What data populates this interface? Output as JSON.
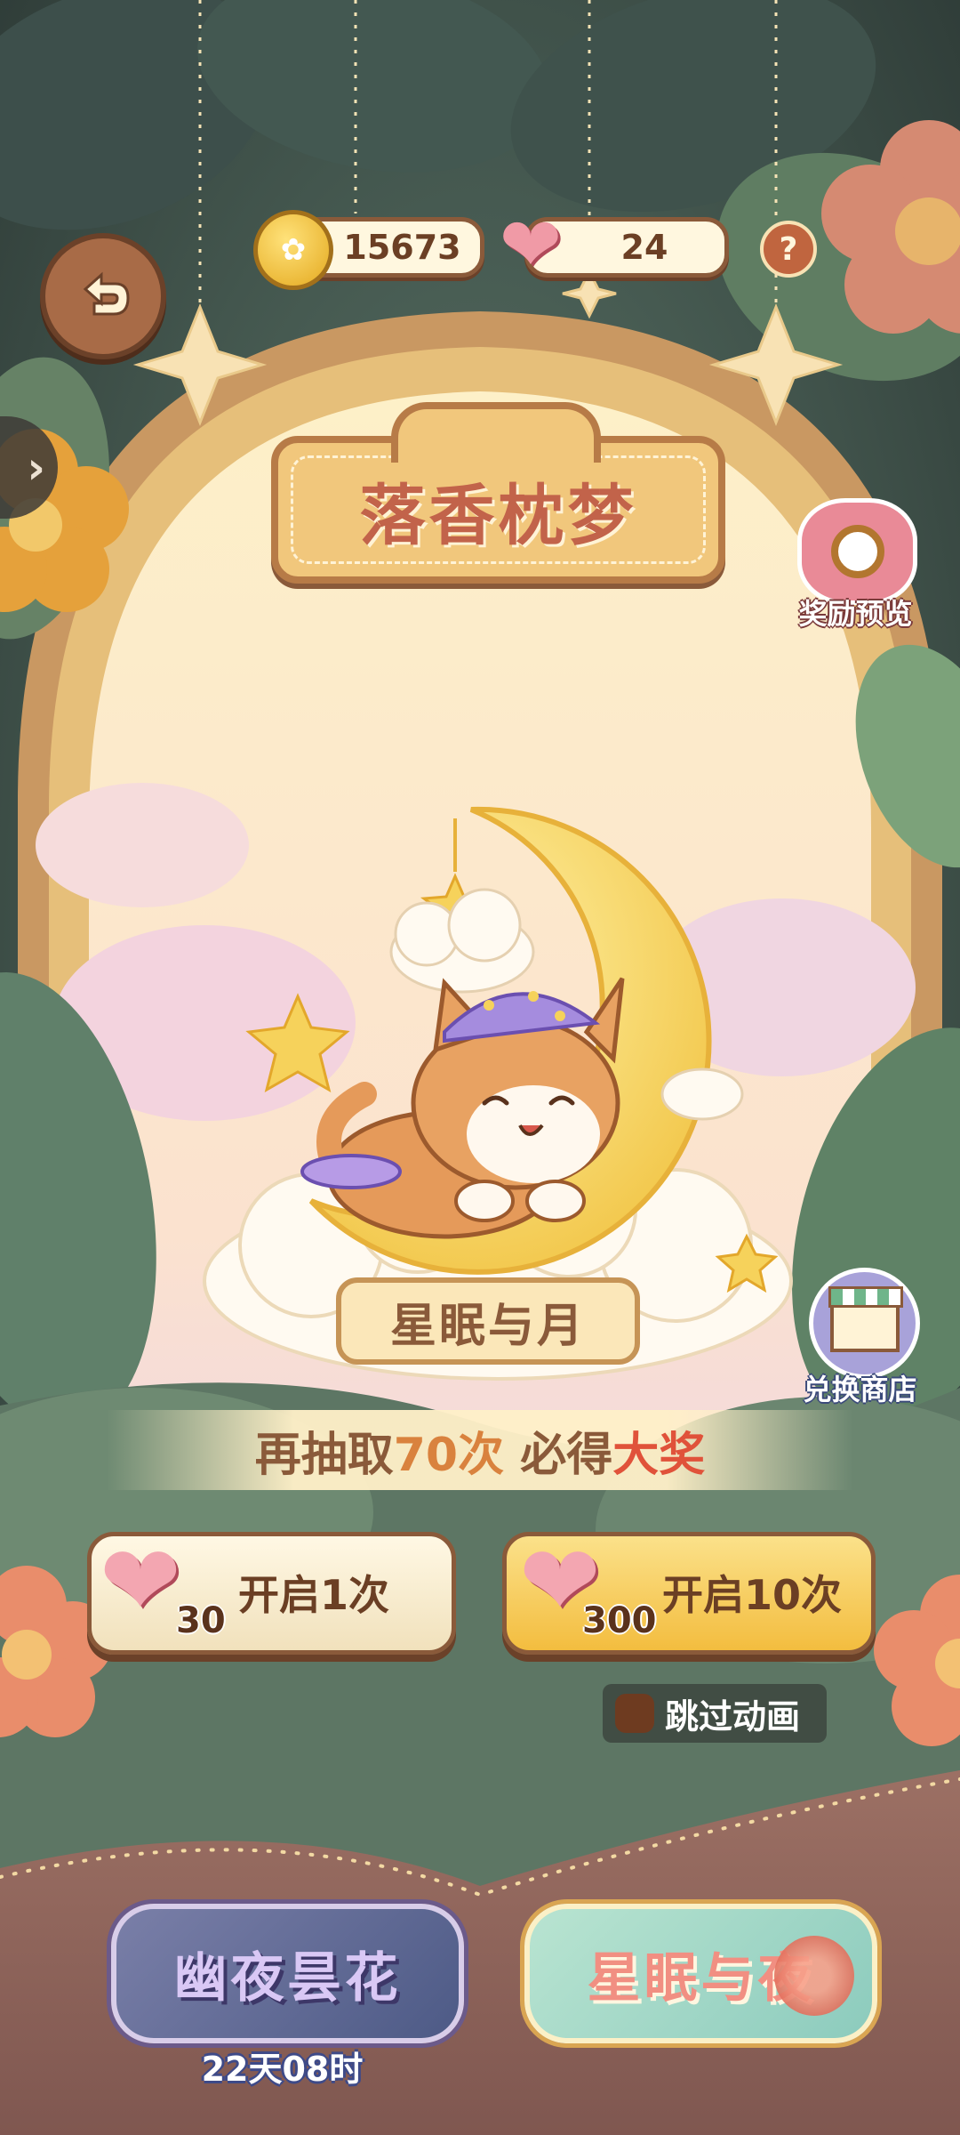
{
  "currency": {
    "coins": "15673",
    "hearts": "24"
  },
  "help_label": "?",
  "title": "落香枕梦",
  "reward_preview_label": "奖励预览",
  "exchange_shop_label": "兑换商店",
  "prize_name": "星眠与月",
  "guarantee": {
    "prefix": "再抽取",
    "count": "70次",
    "middle": " 必得",
    "suffix": "大奖"
  },
  "open_one": {
    "cost": "30",
    "label": "开启1次"
  },
  "open_ten": {
    "cost": "300",
    "label": "开启10次"
  },
  "skip_animation_label": "跳过动画",
  "bottom_tabs": [
    {
      "label": "幽夜昙花",
      "timer": "22天08时"
    },
    {
      "label": "星眠与夜"
    }
  ],
  "colors": {
    "accent_brown": "#8a5a3a",
    "gold": "#f3c95e",
    "highlight_red": "#e0523a"
  },
  "icons": [
    "back-arrow-icon",
    "coin-icon",
    "heart-gem-icon",
    "help-icon",
    "magnifier-icon",
    "shop-icon",
    "side-arrow-icon",
    "skip-checkbox"
  ]
}
